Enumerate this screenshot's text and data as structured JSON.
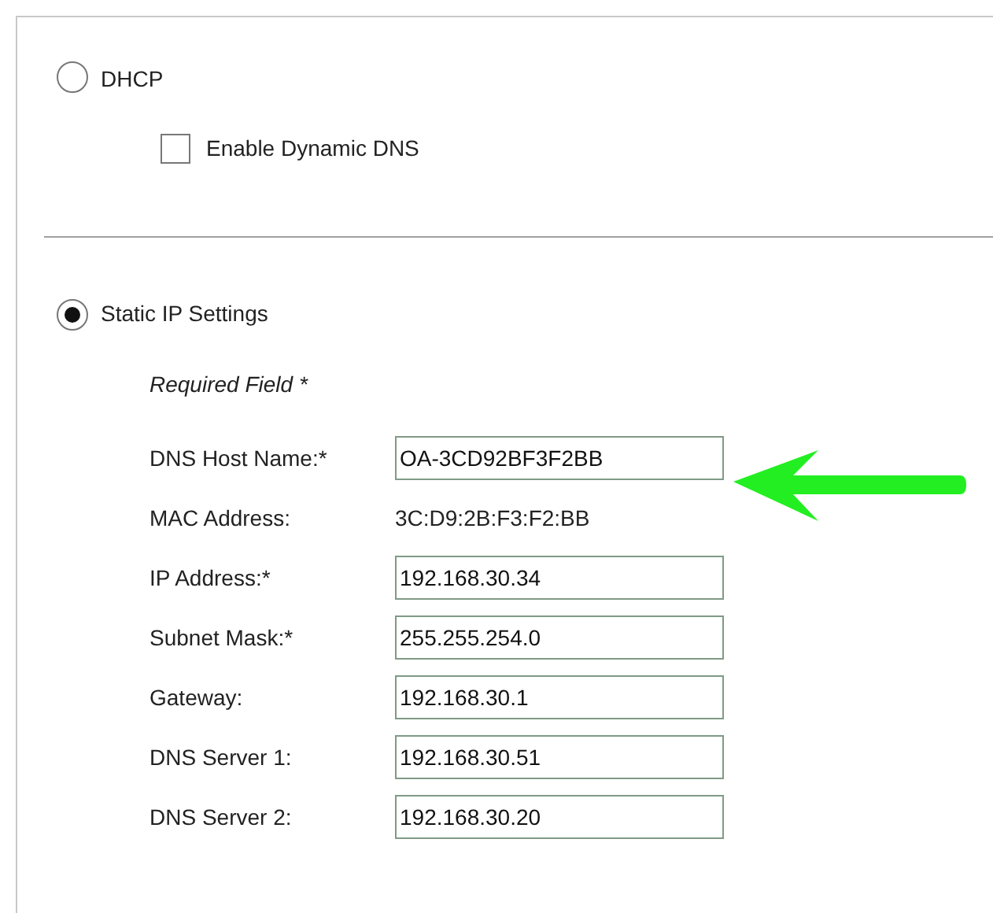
{
  "dhcp": {
    "label": "DHCP",
    "selected": false,
    "dynamic_dns": {
      "label": "Enable Dynamic DNS",
      "checked": false
    }
  },
  "static_ip": {
    "label": "Static IP Settings",
    "selected": true,
    "note": "Required Field *",
    "fields": [
      {
        "kind": "input",
        "label": "DNS Host Name:*",
        "value": "OA-3CD92BF3F2BB"
      },
      {
        "kind": "text",
        "label": "MAC Address:",
        "value": "3C:D9:2B:F3:F2:BB"
      },
      {
        "kind": "input",
        "label": "IP Address:*",
        "value": "192.168.30.34"
      },
      {
        "kind": "input",
        "label": "Subnet Mask:*",
        "value": "255.255.254.0"
      },
      {
        "kind": "input",
        "label": "Gateway:",
        "value": "192.168.30.1"
      },
      {
        "kind": "input",
        "label": "DNS Server 1:",
        "value": "192.168.30.51"
      },
      {
        "kind": "input",
        "label": "DNS Server 2:",
        "value": "192.168.30.20"
      }
    ]
  }
}
